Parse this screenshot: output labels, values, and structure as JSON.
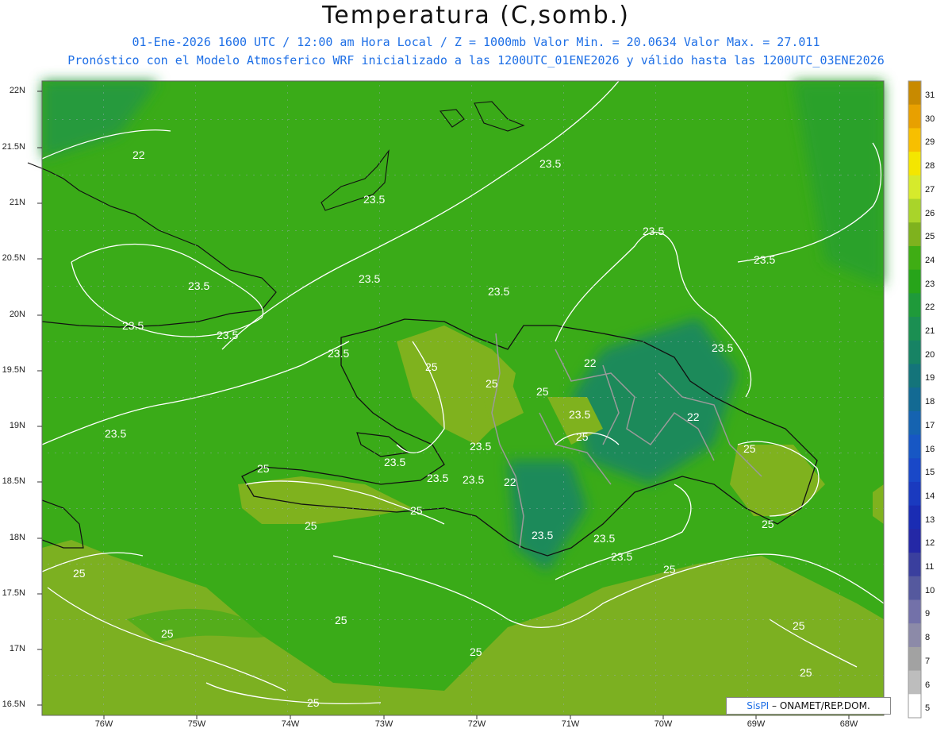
{
  "title": "Temperatura (C,somb.)",
  "subtitle_1": "01-Ene-2026 1600 UTC / 12:00 am Hora Local / Z = 1000mb   Valor Min. = 20.0634  Valor Max. = 27.011",
  "subtitle_2": "Pronóstico con el Modelo Atmosferico WRF inicializado a las 1200UTC_01ENE2026 y válido hasta las  1200UTC_03ENE2026",
  "lat_labels": [
    "22N",
    "21.5N",
    "21N",
    "20.5N",
    "20N",
    "19.5N",
    "19N",
    "18.5N",
    "18N",
    "17.5N",
    "17N",
    "16.5N"
  ],
  "lon_labels": [
    "76W",
    "75W",
    "74W",
    "73W",
    "72W",
    "71W",
    "70W",
    "69W",
    "68W"
  ],
  "colorbar": {
    "labels": [
      "31",
      "30",
      "29",
      "28",
      "27",
      "26",
      "25",
      "24",
      "23",
      "22",
      "21",
      "20",
      "19",
      "18",
      "17",
      "16",
      "15",
      "14",
      "13",
      "12",
      "11",
      "10",
      "9",
      "8",
      "7",
      "6",
      "5"
    ],
    "colors": [
      "#c88a00",
      "#e8a000",
      "#f7bf00",
      "#f4e600",
      "#d6ea2c",
      "#a9d42a",
      "#7fb21e",
      "#3fad14",
      "#27a41a",
      "#1f9a3a",
      "#1b8f52",
      "#178364",
      "#14747a",
      "#136a93",
      "#1563b0",
      "#1757c4",
      "#1948c8",
      "#1a3abf",
      "#1a2cb3",
      "#2428a6",
      "#3a3f9e",
      "#55599e",
      "#7371a9",
      "#8c8aa8",
      "#a2a2a2",
      "#bdbdbd",
      "#ffffff"
    ]
  },
  "contour_labels": [
    "22",
    "23.5",
    "25"
  ],
  "credit": {
    "brand": "SisPI",
    "text": "– ONAMET/REP.DOM."
  }
}
